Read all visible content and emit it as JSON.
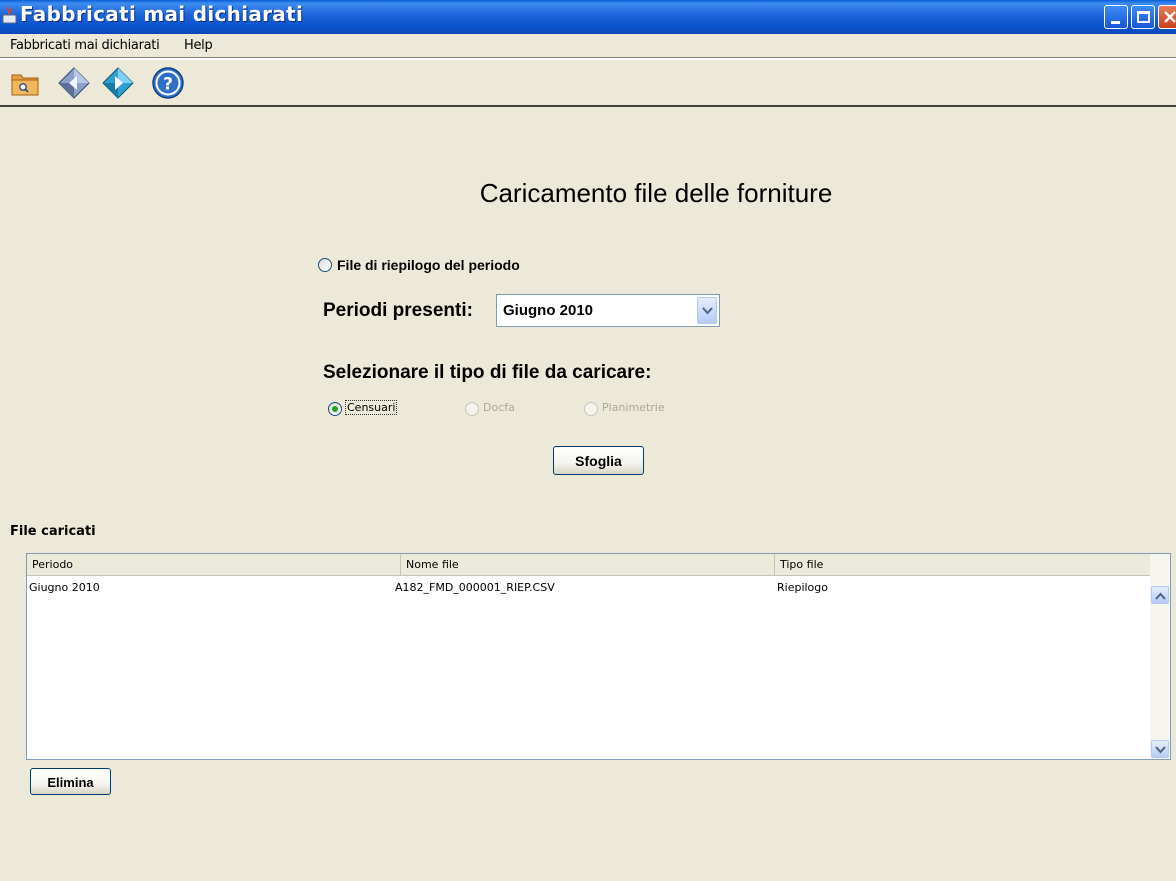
{
  "window": {
    "title": "Fabbricati mai dichiarati"
  },
  "menubar": {
    "items": [
      {
        "label": "Fabbricati mai dichiarati"
      },
      {
        "label": "Help"
      }
    ]
  },
  "toolbar": {
    "buttons": [
      {
        "icon": "folder-search-icon"
      },
      {
        "icon": "diamond-back-icon"
      },
      {
        "icon": "diamond-forward-icon"
      },
      {
        "icon": "help-icon"
      }
    ]
  },
  "main": {
    "heading": "Caricamento file delle forniture",
    "summary_radio_label": "File di riepilogo del periodo",
    "periods_label": "Periodi presenti:",
    "periods_selected": "Giugno 2010",
    "file_type_label": "Selezionare il tipo di file da caricare:",
    "file_types": [
      {
        "label": "Censuari",
        "selected": true,
        "enabled": true
      },
      {
        "label": "Docfa",
        "selected": false,
        "enabled": false
      },
      {
        "label": "Planimetrie",
        "selected": false,
        "enabled": false
      }
    ],
    "browse_button": "Sfoglia"
  },
  "uploaded": {
    "section_label": "File caricati",
    "columns": [
      "Periodo",
      "Nome file",
      "Tipo file"
    ],
    "rows": [
      [
        "Giugno 2010",
        "A182_FMD_000001_RIEP.CSV",
        "Riepilogo"
      ]
    ],
    "delete_button": "Elimina"
  },
  "colors": {
    "background": "#ECE9D8",
    "titlebar": "#0A5FD8",
    "radio_selected": "#21A121"
  }
}
